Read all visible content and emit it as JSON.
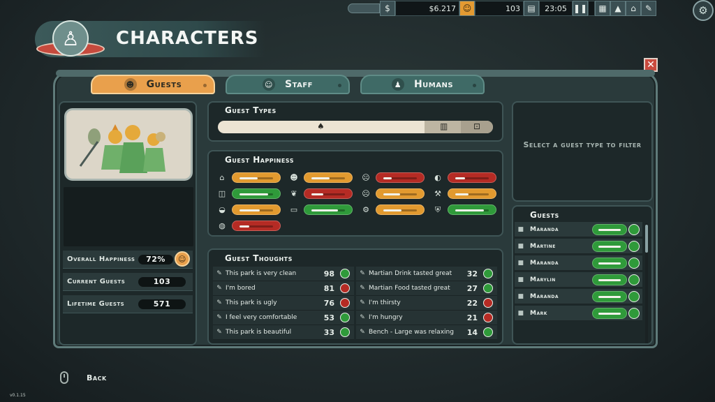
{
  "hud": {
    "money": "$6.217",
    "guest_count": "103",
    "clock": "23:05"
  },
  "title": "CHARACTERS",
  "tabs": [
    {
      "label": "Guests",
      "active": true
    },
    {
      "label": "Staff",
      "active": false
    },
    {
      "label": "Humans",
      "active": false
    }
  ],
  "stats": {
    "overall_happiness_label": "Overall Happiness",
    "overall_happiness_value": "72%",
    "current_guests_label": "Current Guests",
    "current_guests_value": "103",
    "lifetime_guests_label": "Lifetime Guests",
    "lifetime_guests_value": "571"
  },
  "guest_types": {
    "title": "Guest Types",
    "shares": [
      0.75,
      0.13,
      0.12
    ]
  },
  "guest_happiness": {
    "title": "Guest Happiness",
    "items": [
      {
        "icon": "home-icon",
        "color": "#e29a2f",
        "level": 0.55
      },
      {
        "icon": "toilet-icon",
        "color": "#2f9a3a",
        "level": 0.85
      },
      {
        "icon": "bath-icon",
        "color": "#e29a2f",
        "level": 0.6
      },
      {
        "icon": "helmet-icon",
        "color": "#b52b24",
        "level": 0.3
      },
      {
        "icon": "person-icon",
        "color": "#e29a2f",
        "level": 0.55
      },
      {
        "icon": "leaf-icon",
        "color": "#b52b24",
        "level": 0.35
      },
      {
        "icon": "bed-icon",
        "color": "#2f9a3a",
        "level": 0.8
      },
      {
        "icon": "face-icon",
        "color": "#b52b24",
        "level": 0.25
      },
      {
        "icon": "face-icon",
        "color": "#e29a2f",
        "level": 0.5
      },
      {
        "icon": "ride-icon",
        "color": "#e29a2f",
        "level": 0.55
      },
      {
        "icon": "drink-icon",
        "color": "#b52b24",
        "level": 0.3
      },
      {
        "icon": "axe-icon",
        "color": "#e29a2f",
        "level": 0.4
      },
      {
        "icon": "shield-icon",
        "color": "#2f9a3a",
        "level": 0.85
      }
    ]
  },
  "guest_thoughts": {
    "title": "Guest Thoughts",
    "left": [
      {
        "text": "This park is very clean",
        "count": "98",
        "mood": "#2f9a3a"
      },
      {
        "text": "I'm bored",
        "count": "81",
        "mood": "#b52b24"
      },
      {
        "text": "This park is ugly",
        "count": "76",
        "mood": "#b52b24"
      },
      {
        "text": "I feel very comfortable",
        "count": "53",
        "mood": "#2f9a3a"
      },
      {
        "text": "This park is beautiful",
        "count": "33",
        "mood": "#2f9a3a"
      }
    ],
    "right": [
      {
        "text": "Martian Drink tasted great",
        "count": "32",
        "mood": "#2f9a3a"
      },
      {
        "text": "Martian Food tasted great",
        "count": "27",
        "mood": "#2f9a3a"
      },
      {
        "text": "I'm thirsty",
        "count": "22",
        "mood": "#b52b24"
      },
      {
        "text": "I'm hungry",
        "count": "21",
        "mood": "#b52b24"
      },
      {
        "text": "Bench - Large was relaxing",
        "count": "14",
        "mood": "#2f9a3a"
      }
    ]
  },
  "filter_message": "Select a guest type to filter",
  "guests": {
    "title": "Guests",
    "names": [
      "Maranda",
      "Martine",
      "Maranda",
      "Marylin",
      "Maranda",
      "Mark"
    ]
  },
  "back_label": "Back",
  "version": "v0.1.15"
}
